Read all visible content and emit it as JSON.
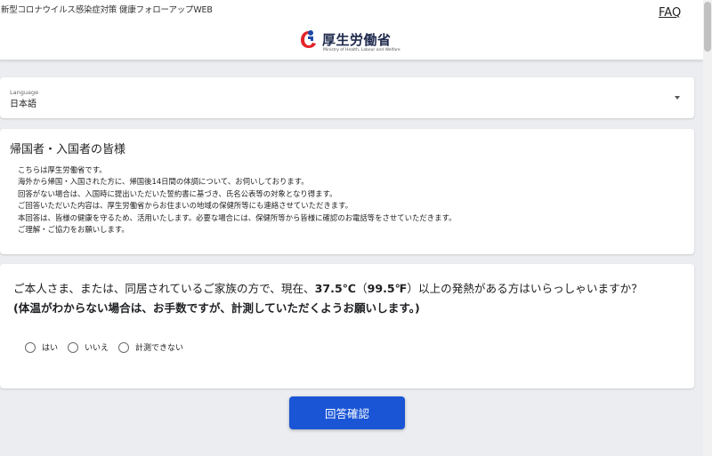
{
  "header": {
    "site_name": "新型コロナウイルス感染症対策 健康フォローアップWEB",
    "faq_label": "FAQ",
    "logo": {
      "name": "厚生労働省",
      "subtitle": "Ministry of Health, Labour and Welfare",
      "mark_color_red": "#e3252b",
      "mark_color_blue": "#1f4aa8"
    }
  },
  "language": {
    "label": "Language",
    "selected": "日本語"
  },
  "notice": {
    "title": "帰国者・入国者の皆様",
    "lines": [
      "こちらは厚生労働省です。",
      "海外から帰国・入国された方に、帰国後14日間の体調について、お伺いしております。",
      "回答がない場合は、入国時に提出いただいた誓約書に基づき、氏名公表等の対象となり得ます。",
      "ご回答いただいた内容は、厚生労働省からお住まいの地域の保健所等にも連絡させていただきます。",
      "本回答は、皆様の健康を守るため、活用いたします。必要な場合には、保健所等から皆様に確認のお電話等をさせていただきます。",
      "ご理解・ご協力をお願いします。"
    ]
  },
  "question": {
    "part1": "ご本人さま、または、同居されているご家族の方で、現在、",
    "temp_c": "37.5℃",
    "part2": "（",
    "temp_f": "99.5℉",
    "part3": "）以上の発熱がある方はいらっしゃいますか？",
    "line2": "(体温がわからない場合は、お手数ですが、計測していただくようお願いします。)",
    "options": [
      "はい",
      "いいえ",
      "計測できない"
    ]
  },
  "submit_label": "回答確認",
  "colors": {
    "background": "#ebedf0",
    "primary_button": "#1a55d6"
  }
}
